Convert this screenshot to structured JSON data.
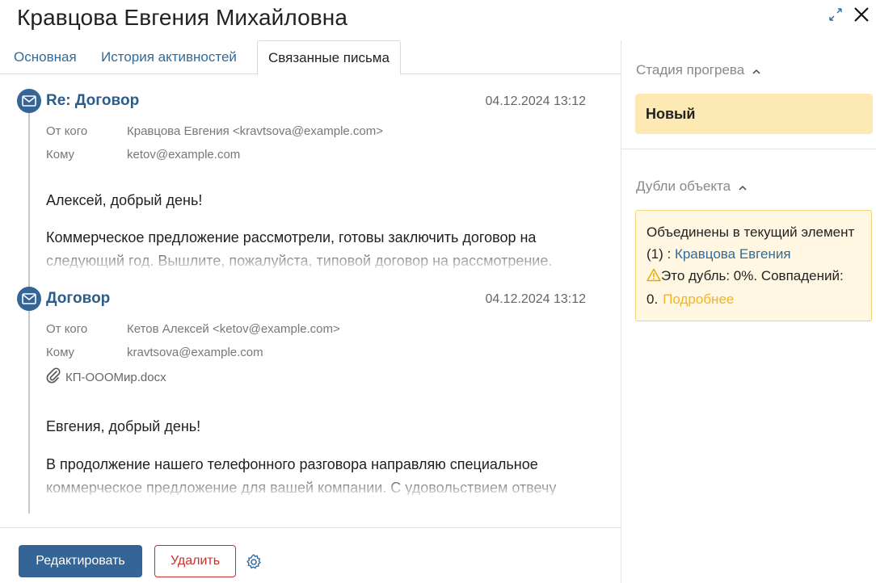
{
  "header": {
    "title": "Кравцова Евгения Михайловна"
  },
  "tabs": [
    {
      "label": "Основная"
    },
    {
      "label": "История активностей"
    },
    {
      "label": "Связанные письма",
      "active": true
    }
  ],
  "emails": [
    {
      "subject": "Re: Договор",
      "date": "04.12.2024 13:12",
      "from_label": "От кого",
      "from_value": "Кравцова Евгения <kravtsova@example.com>",
      "to_label": "Кому",
      "to_value": "ketov@example.com",
      "greeting": "Алексей, добрый день!",
      "body": "Коммерческое предложение рассмотрели, готовы заключить договор на следующий год. Вышлите, пожалуйста, типовой договор на рассмотрение."
    },
    {
      "subject": "Договор",
      "date": "04.12.2024 13:12",
      "from_label": "От кого",
      "from_value": "Кетов Алексей <ketov@example.com>",
      "to_label": "Кому",
      "to_value": "kravtsova@example.com",
      "attachment": "КП-ОООМир.docx",
      "greeting": "Евгения, добрый день!",
      "body": "В продолжение нашего телефонного разговора направляю специальное коммерческое предложение для вашей компании. С удовольствием отвечу"
    }
  ],
  "actions": {
    "edit_label": "Редактировать",
    "delete_label": "Удалить"
  },
  "sidebar": {
    "stage": {
      "title": "Стадия прогрева",
      "value": "Новый"
    },
    "duplicates": {
      "title": "Дубли объекта",
      "merged_text": "Объединены в текущий элемент (1) : ",
      "merged_link": "Кравцова Евгения",
      "dup_text": "Это дубль: 0%. Совпадений: 0.",
      "more_link": "Подробнее"
    }
  },
  "colors": {
    "accent": "#356596",
    "link": "#2f6b9c",
    "danger": "#c9302c",
    "stage_bg": "#fde9b3",
    "dup_bg": "#fff7e1",
    "more": "#f0b429"
  },
  "icons": [
    "expand-icon",
    "close-icon",
    "mail-icon",
    "paperclip-icon",
    "gear-icon",
    "chevron-up-icon",
    "warning-icon"
  ]
}
